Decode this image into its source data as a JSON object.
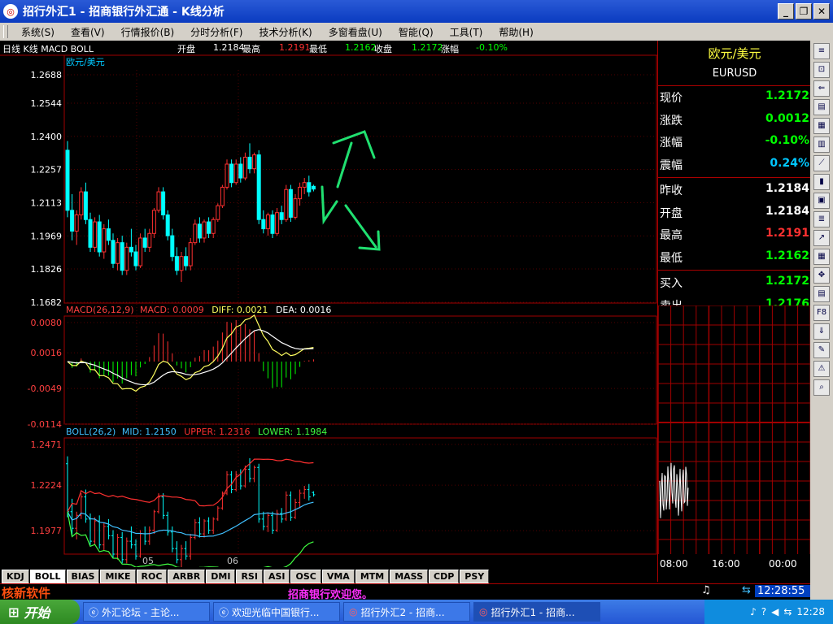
{
  "window": {
    "title": "招行外汇1 - 招商银行外汇通 - K线分析"
  },
  "menu": [
    "系统(S)",
    "查看(V)",
    "行情报价(B)",
    "分时分析(F)",
    "技术分析(K)",
    "多窗看盘(U)",
    "智能(Q)",
    "工具(T)",
    "帮助(H)"
  ],
  "infobar": {
    "label": "日线 K线 MACD BOLL",
    "open_label": "开盘",
    "open": "1.2184",
    "high_label": "最高",
    "high": "1.2191",
    "low_label": "最低",
    "low": "1.2162",
    "close_label": "收盘",
    "close": "1.2172",
    "change_label": "涨幅",
    "change": "-0.10%"
  },
  "chart_data": [
    {
      "type": "candlestick",
      "title": "欧元/美元",
      "yticks": [
        "1.2688",
        "1.2544",
        "1.2400",
        "1.2257",
        "1.2113",
        "1.1969",
        "1.1826",
        "1.1682"
      ],
      "ylim": [
        1.1682,
        1.2688
      ],
      "xticks": [
        "05",
        "06"
      ],
      "candles": [
        [
          1.234,
          1.238,
          1.205,
          1.208
        ],
        [
          1.208,
          1.215,
          1.195,
          1.199
        ],
        [
          1.199,
          1.208,
          1.193,
          1.206
        ],
        [
          1.206,
          1.218,
          1.204,
          1.216
        ],
        [
          1.216,
          1.22,
          1.202,
          1.204
        ],
        [
          1.204,
          1.207,
          1.19,
          1.192
        ],
        [
          1.192,
          1.205,
          1.19,
          1.203
        ],
        [
          1.203,
          1.206,
          1.188,
          1.19
        ],
        [
          1.19,
          1.202,
          1.187,
          1.2
        ],
        [
          1.2,
          1.204,
          1.193,
          1.195
        ],
        [
          1.195,
          1.198,
          1.183,
          1.185
        ],
        [
          1.185,
          1.196,
          1.182,
          1.194
        ],
        [
          1.194,
          1.197,
          1.18,
          1.182
        ],
        [
          1.182,
          1.194,
          1.18,
          1.192
        ],
        [
          1.192,
          1.2,
          1.188,
          1.19
        ],
        [
          1.19,
          1.193,
          1.182,
          1.184
        ],
        [
          1.184,
          1.198,
          1.183,
          1.196
        ],
        [
          1.196,
          1.2,
          1.19,
          1.192
        ],
        [
          1.192,
          1.2,
          1.19,
          1.198
        ],
        [
          1.198,
          1.209,
          1.196,
          1.208
        ],
        [
          1.208,
          1.218,
          1.207,
          1.216
        ],
        [
          1.216,
          1.218,
          1.204,
          1.206
        ],
        [
          1.206,
          1.208,
          1.195,
          1.197
        ],
        [
          1.197,
          1.2,
          1.186,
          1.188
        ],
        [
          1.188,
          1.192,
          1.18,
          1.182
        ],
        [
          1.182,
          1.19,
          1.177,
          1.188
        ],
        [
          1.188,
          1.192,
          1.182,
          1.184
        ],
        [
          1.184,
          1.196,
          1.182,
          1.194
        ],
        [
          1.194,
          1.204,
          1.193,
          1.202
        ],
        [
          1.202,
          1.205,
          1.194,
          1.196
        ],
        [
          1.196,
          1.204,
          1.194,
          1.203
        ],
        [
          1.203,
          1.205,
          1.196,
          1.198
        ],
        [
          1.198,
          1.205,
          1.196,
          1.204
        ],
        [
          1.204,
          1.211,
          1.203,
          1.21
        ],
        [
          1.21,
          1.219,
          1.209,
          1.218
        ],
        [
          1.218,
          1.23,
          1.217,
          1.228
        ],
        [
          1.228,
          1.23,
          1.218,
          1.22
        ],
        [
          1.22,
          1.23,
          1.219,
          1.228
        ],
        [
          1.228,
          1.231,
          1.22,
          1.222
        ],
        [
          1.222,
          1.233,
          1.221,
          1.231
        ],
        [
          1.231,
          1.237,
          1.224,
          1.226
        ],
        [
          1.226,
          1.233,
          1.224,
          1.232
        ],
        [
          1.232,
          1.234,
          1.202,
          1.204
        ],
        [
          1.204,
          1.208,
          1.198,
          1.2
        ],
        [
          1.2,
          1.207,
          1.197,
          1.206
        ],
        [
          1.206,
          1.208,
          1.196,
          1.198
        ],
        [
          1.198,
          1.209,
          1.197,
          1.207
        ],
        [
          1.207,
          1.21,
          1.202,
          1.204
        ],
        [
          1.204,
          1.219,
          1.203,
          1.217
        ],
        [
          1.217,
          1.219,
          1.203,
          1.205
        ],
        [
          1.205,
          1.215,
          1.204,
          1.213
        ],
        [
          1.213,
          1.22,
          1.21,
          1.218
        ],
        [
          1.218,
          1.222,
          1.215,
          1.22
        ],
        [
          1.22,
          1.223,
          1.214,
          1.216
        ],
        [
          1.2184,
          1.2191,
          1.2162,
          1.2172
        ]
      ]
    },
    {
      "type": "macd",
      "title": "MACD(26,12,9)",
      "macd_label": "MACD: 0.0009",
      "diff_label": "DIFF: 0.0021",
      "dea_label": "DEA: 0.0016",
      "yticks": [
        "0.0080",
        "0.0016",
        "-0.0049",
        "-0.0114"
      ],
      "ylim": [
        -0.0114,
        0.008
      ]
    },
    {
      "type": "boll",
      "title": "BOLL(26,2)",
      "mid_label": "MID: 1.2150",
      "upper_label": "UPPER: 1.2316",
      "lower_label": "LOWER: 1.1984",
      "yticks": [
        "1.2471",
        "1.2224",
        "1.1977"
      ],
      "ylim": [
        1.185,
        1.2471
      ]
    }
  ],
  "panel": {
    "name": "欧元/美元",
    "code": "EURUSD",
    "rows": [
      {
        "label": "现价",
        "value": "1.2172",
        "color": "#00ff00"
      },
      {
        "label": "涨跌",
        "value": "0.0012",
        "color": "#00ff00"
      },
      {
        "label": "涨幅",
        "value": "-0.10%",
        "color": "#00ff00"
      },
      {
        "label": "震幅",
        "value": "0.24%",
        "color": "#00c8ff"
      },
      {
        "label": "昨收",
        "value": "1.2184",
        "color": "#ffffff"
      },
      {
        "label": "开盘",
        "value": "1.2184",
        "color": "#ffffff"
      },
      {
        "label": "最高",
        "value": "1.2191",
        "color": "#ff3030"
      },
      {
        "label": "最低",
        "value": "1.2162",
        "color": "#00ff00"
      },
      {
        "label": "买入",
        "value": "1.2172",
        "color": "#00ff00"
      },
      {
        "label": "卖出",
        "value": "1.2176",
        "color": "#00ff00"
      }
    ],
    "time_ticks": [
      "08:00",
      "16:00",
      "00:00"
    ]
  },
  "tabs": [
    "KDJ",
    "BOLL",
    "BIAS",
    "MIKE",
    "ROC",
    "ARBR",
    "DMI",
    "RSI",
    "ASI",
    "OSC",
    "VMA",
    "MTM",
    "MASS",
    "CDP",
    "PSY"
  ],
  "status": {
    "brand": "核新软件",
    "message": "招商银行欢迎您。",
    "time": "12:28:55"
  },
  "taskbar": {
    "start": "开始",
    "tasks": [
      "外汇论坛 - 主论...",
      "欢迎光临中国银行...",
      "招行外汇2 - 招商...",
      "招行外汇1 - 招商..."
    ],
    "clock": "12:28"
  }
}
